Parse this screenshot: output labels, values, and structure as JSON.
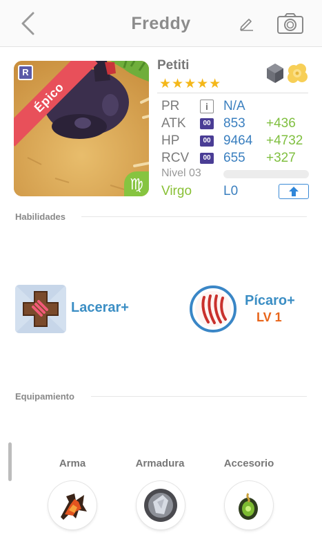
{
  "header": {
    "title": "Freddy",
    "back_icon": "chevron-left-icon",
    "edit_icon": "pencil-icon",
    "camera_icon": "camera-icon"
  },
  "portrait": {
    "rarity_letter": "R",
    "rarity_label": "Épico",
    "zodiac_symbol": "♍"
  },
  "character": {
    "name": "Petiti",
    "stars": "★★★★★",
    "element_icons": [
      "stone-icon",
      "cloud-icon"
    ]
  },
  "stats": [
    {
      "label": "PR",
      "badge": "i",
      "value": "N/A",
      "bonus": ""
    },
    {
      "label": "ATK",
      "badge": "00",
      "value": "853",
      "bonus": "+436"
    },
    {
      "label": "HP",
      "badge": "00",
      "value": "9464",
      "bonus": "+4732"
    },
    {
      "label": "RCV",
      "badge": "00",
      "value": "655",
      "bonus": "+327"
    }
  ],
  "level": {
    "label": "Nivel 03",
    "progress": 0,
    "zodiac": "Virgo",
    "limit": "L0",
    "upgrade_icon": "arrow-up-icon"
  },
  "sections": {
    "abilities": "Habilidades",
    "equipment": "Equipamiento"
  },
  "skills": [
    {
      "name": "Lacerar+",
      "level": "",
      "icon": "lacerate-icon"
    },
    {
      "name": "Pícaro+",
      "level": "LV 1",
      "icon": "claw-icon"
    }
  ],
  "equipment": [
    {
      "label": "Arma",
      "icon": "weapon-icon"
    },
    {
      "label": "Armadura",
      "icon": "armor-icon"
    },
    {
      "label": "Accesorio",
      "icon": "accessory-icon"
    }
  ],
  "colors": {
    "accent_blue": "#3a7fbf",
    "bonus_green": "#7fbf3f",
    "rarity_red": "#e8505a",
    "star_gold": "#f4b719",
    "level_orange": "#e8651a"
  }
}
